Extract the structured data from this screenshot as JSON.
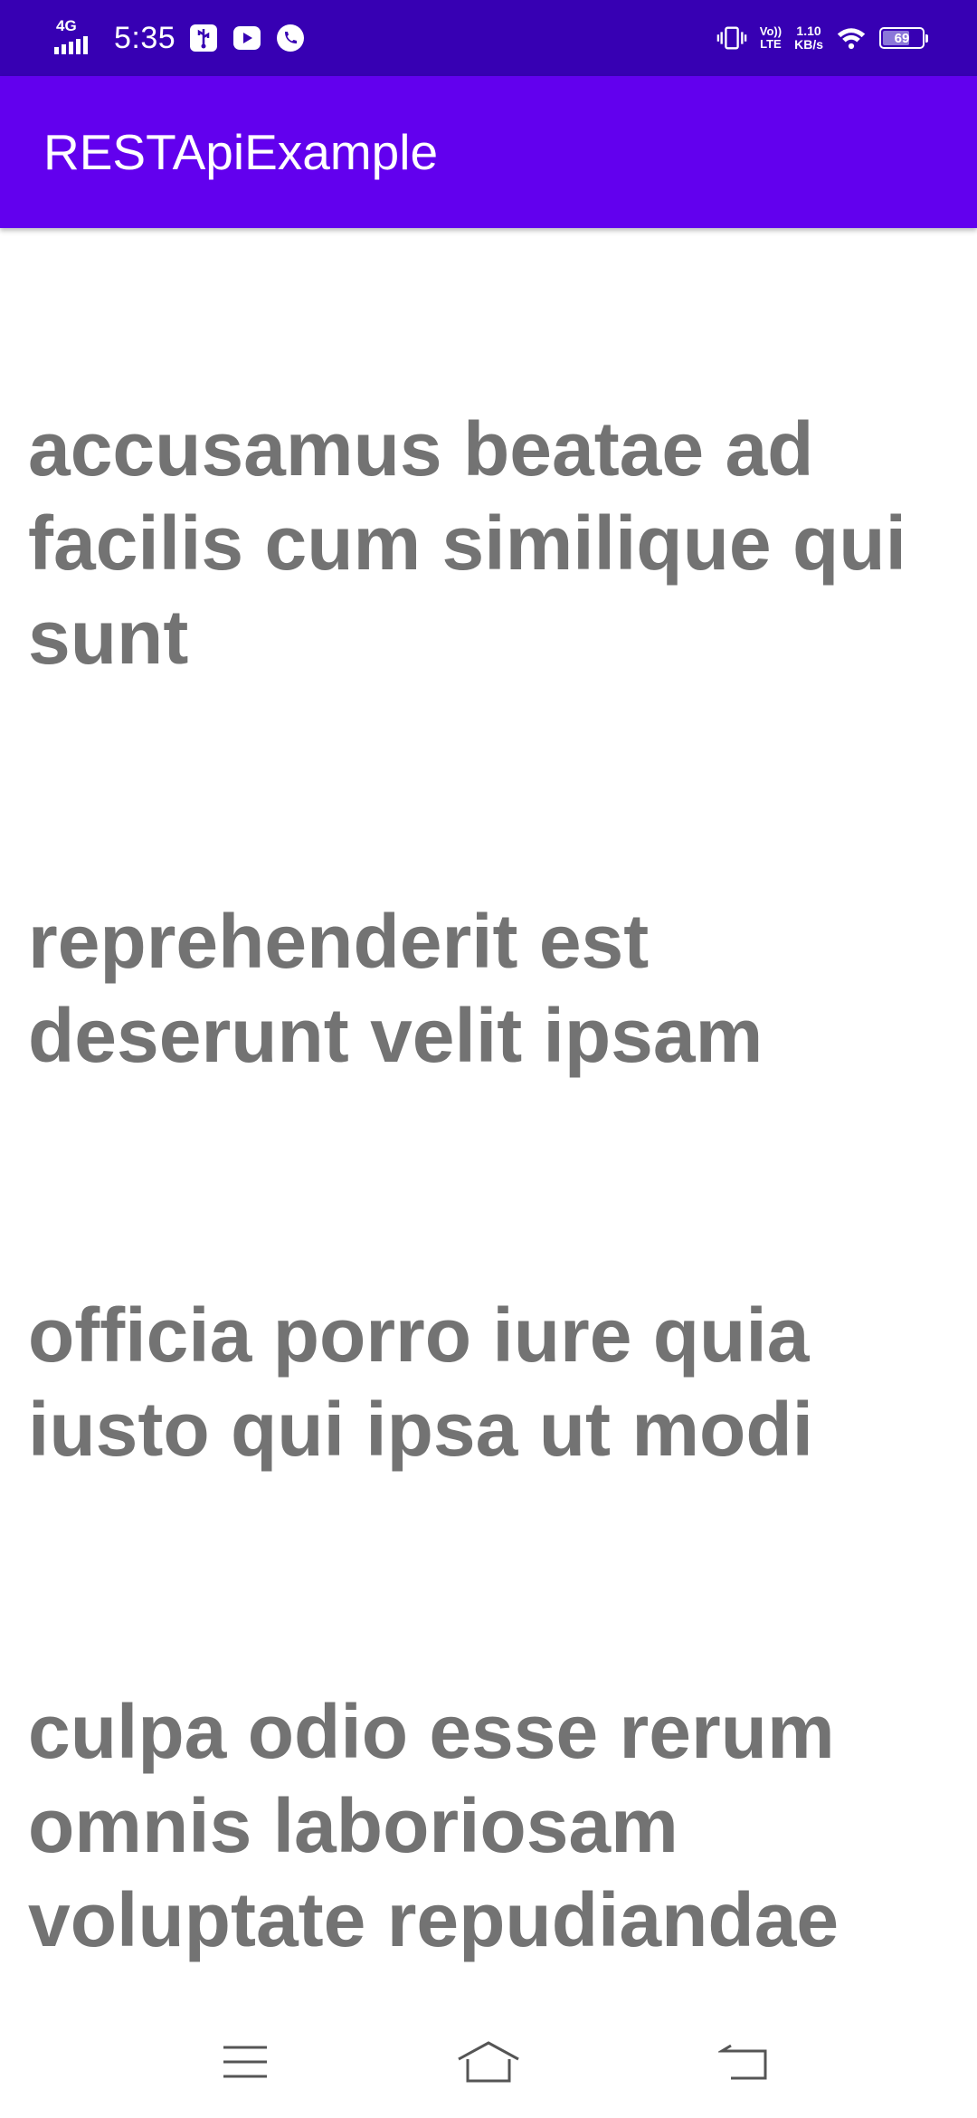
{
  "status_bar": {
    "network_type": "4G",
    "time": "5:35",
    "volte_line1": "Vo))",
    "volte_line2": "LTE",
    "speed_value": "1.10",
    "speed_unit": "KB/s",
    "battery_level": "69",
    "battery_fraction": 0.69,
    "icons": [
      "signal-bars-icon",
      "usb-debug-icon",
      "youtube-icon",
      "phone-call-icon",
      "vibrate-icon",
      "wifi-icon",
      "battery-icon"
    ]
  },
  "app_bar": {
    "title": "RESTApiExample",
    "color": "#6200ee",
    "status_color": "#3700b3"
  },
  "list": {
    "text_color": "#737373",
    "items": [
      {
        "title": "accusamus beatae ad facilis cum similique qui sunt"
      },
      {
        "title": "reprehenderit est deserunt velit ipsam"
      },
      {
        "title": "officia porro iure quia iusto qui ipsa ut modi"
      },
      {
        "title": "culpa odio esse rerum omnis laboriosam voluptate repudiandae"
      }
    ]
  },
  "nav_bar": {
    "buttons": [
      "menu-icon",
      "home-icon",
      "back-icon"
    ]
  }
}
